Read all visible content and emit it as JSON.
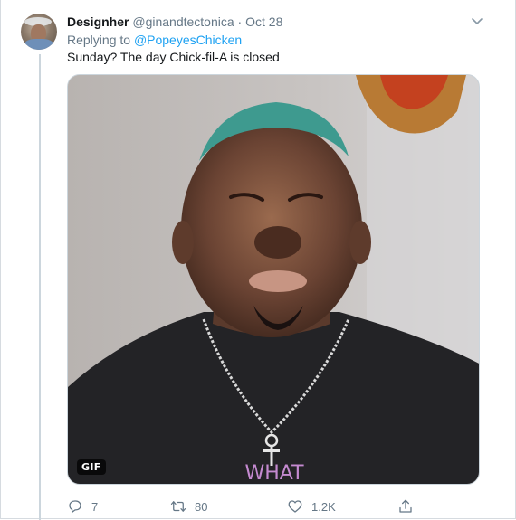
{
  "tweet": {
    "author_name": "Designher",
    "author_handle": "@ginandtectonica",
    "separator": "·",
    "date": "Oct 28",
    "replying_prefix": "Replying to",
    "replying_handle": "@PopeyesChicken",
    "text": "Sunday? The day Chick-fil-A is closed",
    "media_badge": "GIF",
    "shirt_text": "WHAT"
  },
  "actions": {
    "reply_count": "7",
    "retweet_count": "80",
    "like_count": "1.2K"
  },
  "colors": {
    "link": "#1da1f2",
    "muted": "#657786",
    "text": "#14171a"
  },
  "icons": {
    "caret": "chevron-down-icon",
    "reply": "reply-icon",
    "retweet": "retweet-icon",
    "like": "heart-icon",
    "share": "share-icon"
  }
}
